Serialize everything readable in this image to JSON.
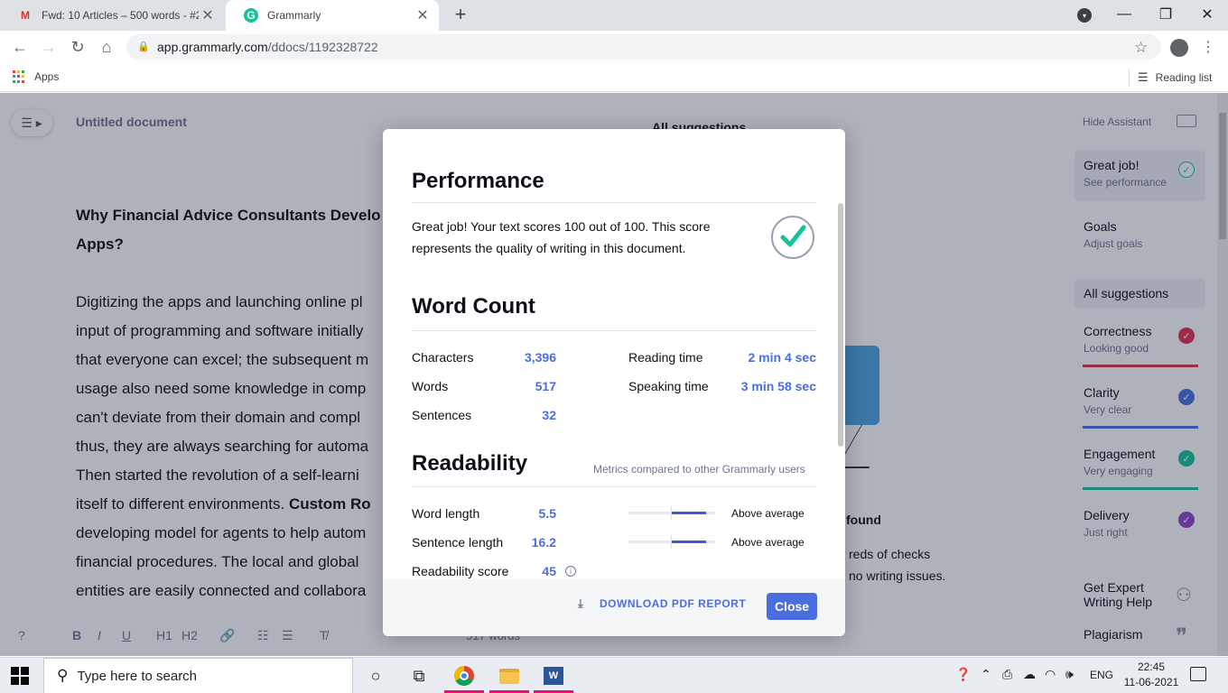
{
  "browser": {
    "tabs": [
      {
        "title": "Fwd: 10 Articles – 500 words - #2",
        "favicon": "gmail-icon"
      },
      {
        "title": "Grammarly",
        "favicon": "grammarly-icon"
      }
    ],
    "new_tab_symbol": "+",
    "url_domain": "app.grammarly.com",
    "url_path": "/ddocs/1192328722",
    "bookmarks": {
      "apps_label": "Apps",
      "reading_list_label": "Reading list"
    }
  },
  "editor": {
    "doc_title": "Untitled document",
    "heading": "Why Financial Advice Consultants Develo Apps?",
    "heading_lines": [
      "Why Financial Advice Consultants Develo",
      "Apps?"
    ],
    "body_lines": [
      "Digitizing the apps and launching online pl",
      "input of programming and software initially",
      "that everyone can excel; the subsequent m",
      "usage also need some knowledge in comp",
      "can't deviate from their domain and compl",
      "thus, they are always searching for automa",
      "Then started the revolution of a self-learni",
      "itself to different environments.",
      "developing model for agents to help autom",
      "financial procedures. The local and global",
      "entities are easily connected and collabora"
    ],
    "bold_fragment": "Custom Ro",
    "word_count": "517 words",
    "toolbar": [
      "?",
      "B",
      "I",
      "U",
      "H1",
      "H2",
      "link-icon",
      "ordered-list-icon",
      "bullet-list-icon",
      "clear-format-icon"
    ]
  },
  "middle": {
    "title": "All suggestions",
    "found_text": "found",
    "checks_text_1": "reds of checks",
    "checks_text_2": "no writing issues."
  },
  "assistant": {
    "hide_label": "Hide Assistant",
    "cards": [
      {
        "main": "Great job!",
        "sub": "See performance",
        "icon": "check-circle-icon"
      },
      {
        "main": "Goals",
        "sub": "Adjust goals"
      }
    ],
    "all_suggestions": "All suggestions",
    "categories": [
      {
        "main": "Correctness",
        "sub": "Looking good",
        "color": "#e0324f"
      },
      {
        "main": "Clarity",
        "sub": "Very clear",
        "color": "#4a6ee0"
      },
      {
        "main": "Engagement",
        "sub": "Very engaging",
        "color": "#15c39a"
      },
      {
        "main": "Delivery",
        "sub": "Just right",
        "color": "#8e44c9"
      }
    ],
    "expert_help": "Get Expert Writing Help",
    "plagiarism": "Plagiarism"
  },
  "modal": {
    "performance_title": "Performance",
    "performance_text": "Great job! Your text scores 100 out of 100. This score represents the quality of writing in this document.",
    "word_count_title": "Word Count",
    "stats_left": [
      {
        "label": "Characters",
        "value": "3,396"
      },
      {
        "label": "Words",
        "value": "517"
      },
      {
        "label": "Sentences",
        "value": "32"
      }
    ],
    "stats_right": [
      {
        "label": "Reading time",
        "value": "2 min 4 sec"
      },
      {
        "label": "Speaking time",
        "value": "3 min 58 sec"
      }
    ],
    "readability_title": "Readability",
    "readability_note": "Metrics compared to other Grammarly users",
    "readability": [
      {
        "label": "Word length",
        "value": "5.5",
        "comparison": "Above average",
        "level_from": 0.5,
        "level_to": 0.9
      },
      {
        "label": "Sentence length",
        "value": "16.2",
        "comparison": "Above average",
        "level_from": 0.5,
        "level_to": 0.9
      },
      {
        "label": "Readability score",
        "value": "45"
      }
    ],
    "download_label": "DOWNLOAD PDF REPORT",
    "close_label": "Close",
    "accent": "#4a6ee0",
    "success": "#15c39a"
  },
  "taskbar": {
    "search_placeholder": "Type here to search",
    "language": "ENG",
    "time": "22:45",
    "date": "11-06-2021"
  }
}
